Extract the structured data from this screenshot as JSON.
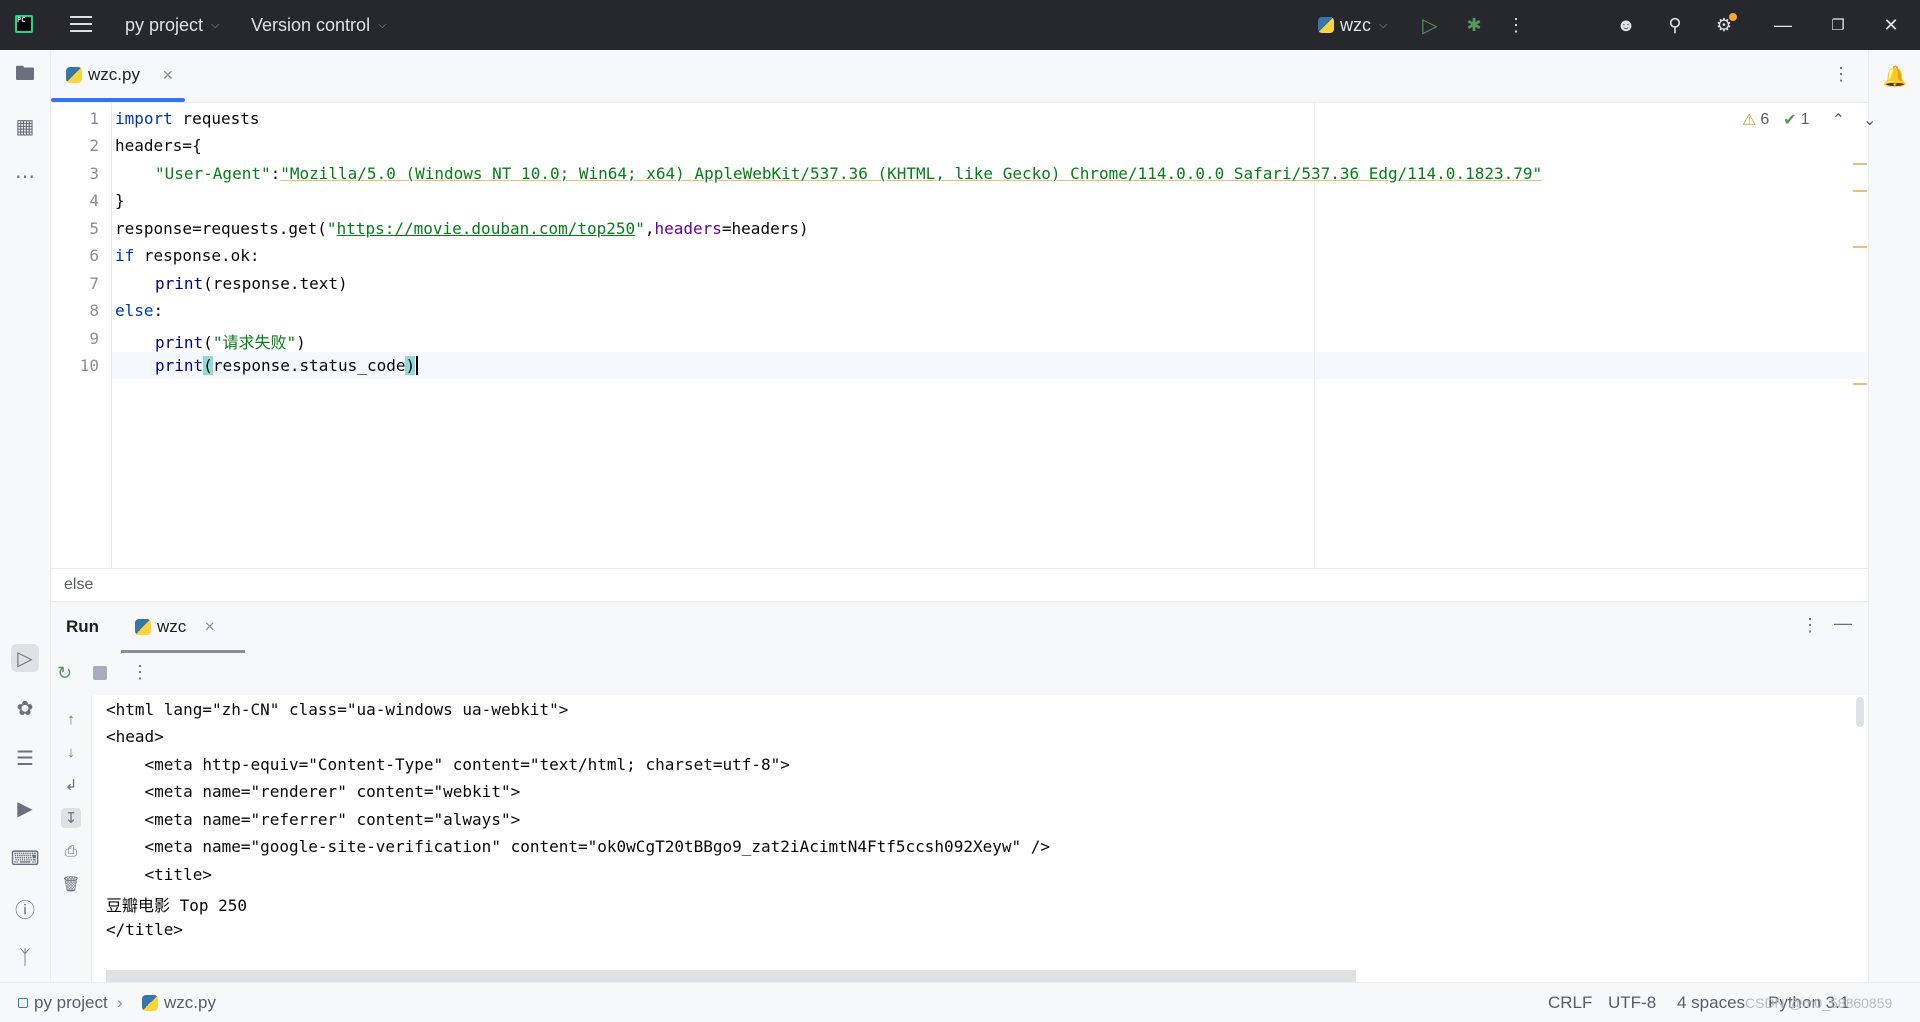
{
  "titlebar": {
    "project": "py project",
    "vcs": "Version control",
    "run_config": "wzc"
  },
  "tabs": [
    {
      "label": "wzc.py"
    }
  ],
  "inspections": {
    "warnings": "6",
    "ok": "1"
  },
  "code_lines": [
    {
      "n": "1"
    },
    {
      "n": "2"
    },
    {
      "n": "3"
    },
    {
      "n": "4"
    },
    {
      "n": "5"
    },
    {
      "n": "6"
    },
    {
      "n": "7"
    },
    {
      "n": "8"
    },
    {
      "n": "9"
    },
    {
      "n": "10"
    }
  ],
  "code": {
    "l1_kw": "import",
    "l1_rest": " requests",
    "l2": "headers={",
    "l3_key": "\"User-Agent\"",
    "l3_colon": ":",
    "l3_val": "\"Mozilla/5.0 (Windows NT 10.0; Win64; x64) AppleWebKit/537.36 (KHTML, like Gecko) Chrome/114.0.0.0 Safari/537.36 Edg/114.0.1823.79\"",
    "l4": "}",
    "l5_a": "response=requests.get(",
    "l5_q1": "\"",
    "l5_url": "https://movie.douban.com/top250",
    "l5_q2": "\"",
    "l5_comma": ",",
    "l5_param": "headers",
    "l5_rest": "=headers)",
    "l6_kw": "if",
    "l6_rest": " response.ok:",
    "l7_fn": "print",
    "l7_rest": "(response.text)",
    "l8_kw": "else",
    "l8_rest": ":",
    "l9_fn": "print",
    "l9_p1": "(",
    "l9_str": "\"请求失败\"",
    "l9_p2": ")",
    "l10_fn": "print",
    "l10_p1": "(",
    "l10_mid": "response.status_code",
    "l10_p2": ")"
  },
  "breadcrumb": "else",
  "run": {
    "title": "Run",
    "tab_label": "wzc"
  },
  "output": [
    "<html lang=\"zh-CN\" class=\"ua-windows ua-webkit\">",
    "<head>",
    "    <meta http-equiv=\"Content-Type\" content=\"text/html; charset=utf-8\">",
    "    <meta name=\"renderer\" content=\"webkit\">",
    "    <meta name=\"referrer\" content=\"always\">",
    "    <meta name=\"google-site-verification\" content=\"ok0wCgT20tBBgo9_zat2iAcimtN4Ftf5ccsh092Xeyw\" />",
    "    <title>",
    "豆瓣电影 Top 250",
    "</title>"
  ],
  "status": {
    "project": "py project",
    "file": "wzc.py",
    "line_sep": "CRLF",
    "encoding": "UTF-8",
    "indent": "4 spaces",
    "interpreter": "Python 3.1",
    "watermark": "CSDN @m0_58860859"
  }
}
